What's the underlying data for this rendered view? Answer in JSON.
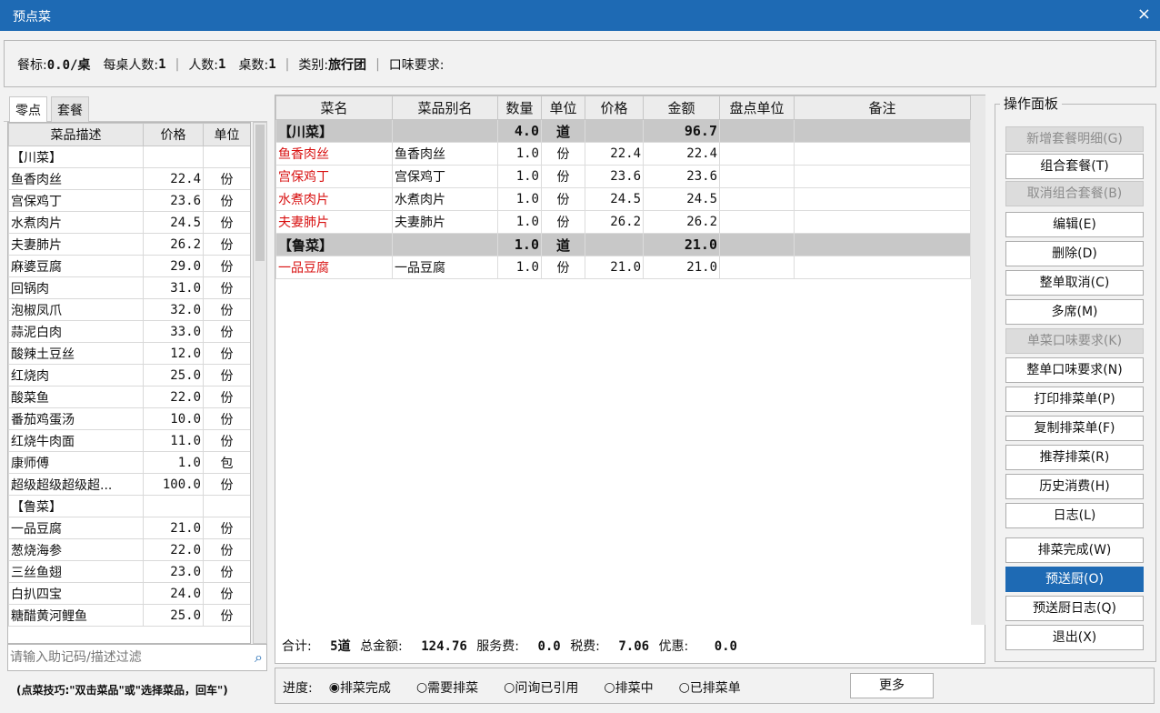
{
  "window": {
    "title": "预点菜",
    "close": "×"
  },
  "info": {
    "l1": "餐标:",
    "v1": "0.0/桌",
    "l2": "每桌人数:",
    "v2": "1",
    "l3": "人数:",
    "v3": "1",
    "l4": "桌数:",
    "v4": "1",
    "l5": "类别:",
    "v5": "旅行团",
    "l6": "口味要求:",
    "sep": "|"
  },
  "left": {
    "tabs": [
      "零点",
      "套餐"
    ],
    "headers": [
      "菜品描述",
      "价格",
      "单位"
    ],
    "rows": [
      {
        "name": "【川菜】",
        "price": "",
        "unit": "",
        "group": true
      },
      {
        "name": "鱼香肉丝",
        "price": "22.4",
        "unit": "份"
      },
      {
        "name": "宫保鸡丁",
        "price": "23.6",
        "unit": "份"
      },
      {
        "name": "水煮肉片",
        "price": "24.5",
        "unit": "份"
      },
      {
        "name": "夫妻肺片",
        "price": "26.2",
        "unit": "份"
      },
      {
        "name": "麻婆豆腐",
        "price": "29.0",
        "unit": "份"
      },
      {
        "name": "回锅肉",
        "price": "31.0",
        "unit": "份"
      },
      {
        "name": "泡椒凤爪",
        "price": "32.0",
        "unit": "份"
      },
      {
        "name": "蒜泥白肉",
        "price": "33.0",
        "unit": "份"
      },
      {
        "name": "酸辣土豆丝",
        "price": "12.0",
        "unit": "份"
      },
      {
        "name": "红烧肉",
        "price": "25.0",
        "unit": "份"
      },
      {
        "name": "酸菜鱼",
        "price": "22.0",
        "unit": "份"
      },
      {
        "name": "番茄鸡蛋汤",
        "price": "10.0",
        "unit": "份"
      },
      {
        "name": "红烧牛肉面",
        "price": "11.0",
        "unit": "份"
      },
      {
        "name": "康师傅",
        "price": "1.0",
        "unit": "包"
      },
      {
        "name": "超级超级超级超...",
        "price": "100.0",
        "unit": "份"
      },
      {
        "name": "【鲁菜】",
        "price": "",
        "unit": "",
        "group": true
      },
      {
        "name": "一品豆腐",
        "price": "21.0",
        "unit": "份"
      },
      {
        "name": "葱烧海参",
        "price": "22.0",
        "unit": "份"
      },
      {
        "name": "三丝鱼翅",
        "price": "23.0",
        "unit": "份"
      },
      {
        "name": "白扒四宝",
        "price": "24.0",
        "unit": "份"
      },
      {
        "name": "糖醋黄河鲤鱼",
        "price": "25.0",
        "unit": "份"
      }
    ],
    "filter_placeholder": "请输入助记码/描述过滤",
    "tip": "(点菜技巧:\"双击菜品\"或\"选择菜品，回车\")"
  },
  "order": {
    "headers": [
      "菜名",
      "菜品别名",
      "数量",
      "单位",
      "价格",
      "金额",
      "盘点单位",
      "备注"
    ],
    "rows": [
      {
        "name": "【川菜】",
        "alias": "",
        "qty": "4.0",
        "unit": "道",
        "price": "",
        "amount": "96.7",
        "pd": "",
        "note": "",
        "group": true
      },
      {
        "name": "鱼香肉丝",
        "alias": "鱼香肉丝",
        "qty": "1.0",
        "unit": "份",
        "price": "22.4",
        "amount": "22.4",
        "pd": "",
        "note": ""
      },
      {
        "name": "宫保鸡丁",
        "alias": "宫保鸡丁",
        "qty": "1.0",
        "unit": "份",
        "price": "23.6",
        "amount": "23.6",
        "pd": "",
        "note": ""
      },
      {
        "name": "水煮肉片",
        "alias": "水煮肉片",
        "qty": "1.0",
        "unit": "份",
        "price": "24.5",
        "amount": "24.5",
        "pd": "",
        "note": ""
      },
      {
        "name": "夫妻肺片",
        "alias": "夫妻肺片",
        "qty": "1.0",
        "unit": "份",
        "price": "26.2",
        "amount": "26.2",
        "pd": "",
        "note": ""
      },
      {
        "name": "【鲁菜】",
        "alias": "",
        "qty": "1.0",
        "unit": "道",
        "price": "",
        "amount": "21.0",
        "pd": "",
        "note": "",
        "group": true
      },
      {
        "name": "一品豆腐",
        "alias": "一品豆腐",
        "qty": "1.0",
        "unit": "份",
        "price": "21.0",
        "amount": "21.0",
        "pd": "",
        "note": ""
      }
    ],
    "totals": {
      "l1": "合计:",
      "v1": "5道",
      "l2": "总金额:",
      "v2": "124.76",
      "l3": "服务费:",
      "v3": "0.0",
      "l4": "税费:",
      "v4": "7.06",
      "l5": "优惠:",
      "v5": "0.0"
    }
  },
  "progress": {
    "label": "进度:",
    "options": [
      {
        "label": "排菜完成",
        "checked": true
      },
      {
        "label": "需要排菜",
        "checked": false
      },
      {
        "label": "问询已引用",
        "checked": false
      },
      {
        "label": "排菜中",
        "checked": false
      },
      {
        "label": "已排菜单",
        "checked": false
      }
    ],
    "more": "更多"
  },
  "ops": {
    "title": "操作面板",
    "buttons": [
      {
        "label": "新增套餐明细(G)",
        "state": "disabled"
      },
      {
        "label": "组合套餐(T)",
        "state": "normal"
      },
      {
        "label": "取消组合套餐(B)",
        "state": "disabled"
      },
      {
        "label": "编辑(E)",
        "state": "normal"
      },
      {
        "label": "删除(D)",
        "state": "normal"
      },
      {
        "label": "整单取消(C)",
        "state": "normal"
      },
      {
        "label": "多席(M)",
        "state": "normal"
      },
      {
        "label": "单菜口味要求(K)",
        "state": "disabled"
      },
      {
        "label": "整单口味要求(N)",
        "state": "normal"
      },
      {
        "label": "打印排菜单(P)",
        "state": "normal"
      },
      {
        "label": "复制排菜单(F)",
        "state": "normal"
      },
      {
        "label": "推荐排菜(R)",
        "state": "normal"
      },
      {
        "label": "历史消费(H)",
        "state": "normal"
      },
      {
        "label": "日志(L)",
        "state": "normal"
      },
      {
        "label": "排菜完成(W)",
        "state": "normal"
      },
      {
        "label": "预送厨(O)",
        "state": "highlighted"
      },
      {
        "label": "预送厨日志(Q)",
        "state": "normal"
      },
      {
        "label": "退出(X)",
        "state": "normal"
      }
    ]
  },
  "colors": {
    "accent": "#1e6ab4",
    "group_row": "#c8c8c8",
    "dish_name_red": "#d81010"
  }
}
